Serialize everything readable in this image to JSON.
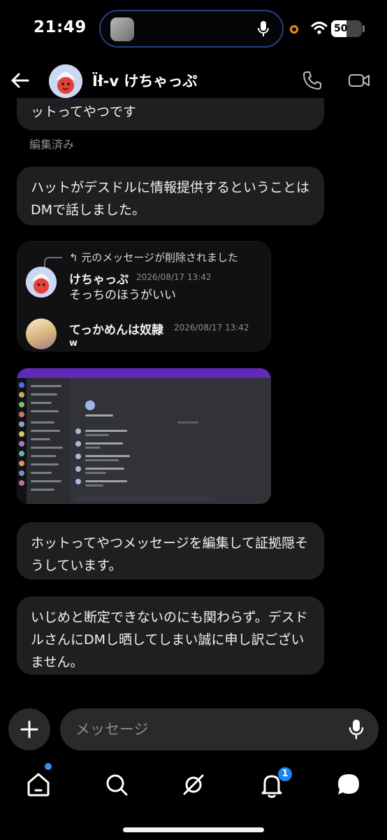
{
  "status_bar": {
    "time": "21:49",
    "battery": "50",
    "battery_level_percent": 50,
    "recording_dot_color": "#f08a19"
  },
  "header": {
    "contact_name": "Ïł-v けちゃっぷ",
    "back_icon": "back-arrow-icon",
    "call_icon": "phone-icon",
    "video_icon": "video-camera-icon"
  },
  "messages": [
    {
      "text": "ットってやつです",
      "status": "編集済み"
    },
    {
      "text": "ハットがデスドルに情報提供するということはDMで話しました。"
    },
    {
      "text": "ホットってやつメッセージを編集して証拠隠そうしています。"
    },
    {
      "text": "いじめと断定できないのにも関わらず。デスドルさんにDMし晒してしまい誠に申し訳ございません。"
    }
  ],
  "quoted_card": {
    "reply_notice": "元のメッセージが削除されました",
    "entries": [
      {
        "author": "けちゃっぷ",
        "timestamp": "2026/08/17 13:42",
        "text": "そっちのほうがいい"
      },
      {
        "author": "てっかめんは奴隷",
        "timestamp": "2026/08/17 13:42",
        "text": "w"
      }
    ]
  },
  "composer": {
    "placeholder": "メッセージ",
    "add_icon": "plus-icon",
    "mic_icon": "microphone-icon"
  },
  "tabbar": {
    "items": [
      "home-icon",
      "search-icon",
      "explore-icon",
      "notifications-icon",
      "messages-icon"
    ],
    "notification_count": "1",
    "accent_color": "#1e83f2"
  }
}
